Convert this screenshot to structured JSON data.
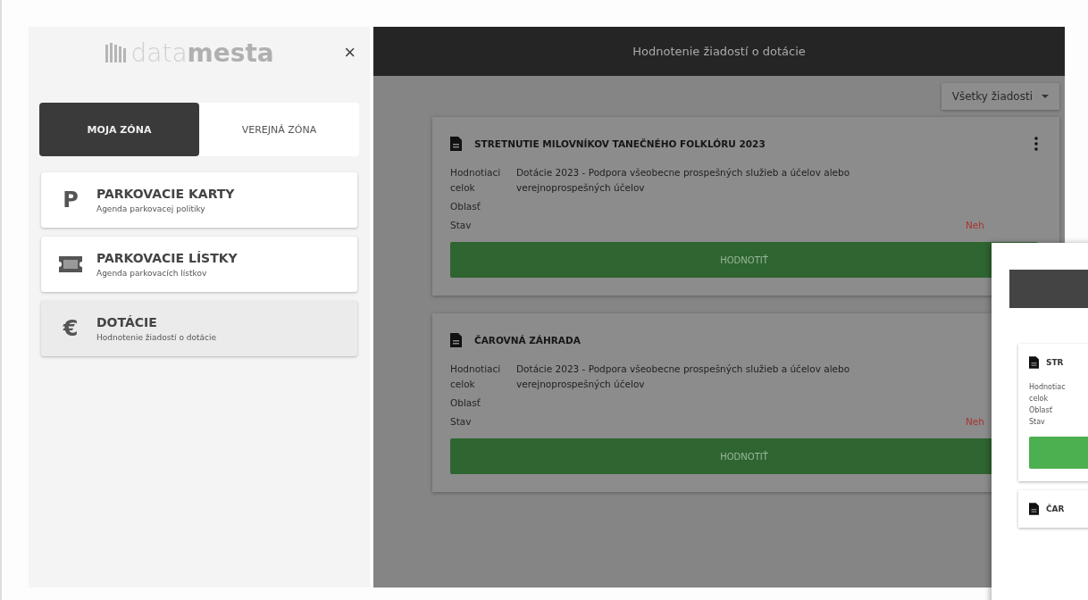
{
  "sidebar": {
    "logo": {
      "light": "data",
      "bold": "mesta"
    },
    "close": "×",
    "tabs": [
      {
        "label": "MOJA ZÓNA",
        "selected": true
      },
      {
        "label": "VEREJNÁ ZÓNA",
        "selected": false
      }
    ],
    "items": [
      {
        "kind": "glyph",
        "glyph": "P",
        "title": "PARKOVACIE KARTY",
        "subtitle": "Agenda parkovacej politiky",
        "selected": false
      },
      {
        "kind": "ticket",
        "title": "PARKOVACIE LÍSTKY",
        "subtitle": "Agenda parkovacích lístkov",
        "selected": false
      },
      {
        "kind": "glyph",
        "glyph": "€",
        "title": "DOTÁCIE",
        "subtitle": "Hodnotenie žiadostí o dotácie",
        "selected": true
      }
    ]
  },
  "header": {
    "title": "Hodnotenie žiadostí o dotácie"
  },
  "filter": {
    "value": "Všetky žiadosti"
  },
  "cards": [
    {
      "title": "STRETNUTIE MILOVNÍKOV TANEČNÉHO FOLKLÓRU 2023",
      "fields": [
        {
          "label": "Hodnotiaci celok",
          "value": "Dotácie 2023 - Podpora všeobecne prospešných služieb a účelov alebo verejnoprospešných účelov"
        },
        {
          "label": "Oblasť"
        },
        {
          "label": "Stav",
          "status": "Neh"
        }
      ],
      "button": "HODNOTIŤ"
    },
    {
      "title": "ČAROVNÁ ZÁHRADA",
      "fields": [
        {
          "label": "Hodnotiaci celok",
          "value": "Dotácie 2023 - Podpora všeobecne prospešných služieb a účelov alebo verejnoprospešných účelov"
        },
        {
          "label": "Oblasť"
        },
        {
          "label": "Stav",
          "status": "Neh"
        }
      ],
      "button": "HODNOTIŤ"
    }
  ],
  "overlay": {
    "cards": [
      {
        "title": "STR",
        "labels": [
          "Hodnotiac",
          "celok",
          "Oblasť",
          "Stav"
        ]
      },
      {
        "title": "ČAR"
      }
    ]
  }
}
